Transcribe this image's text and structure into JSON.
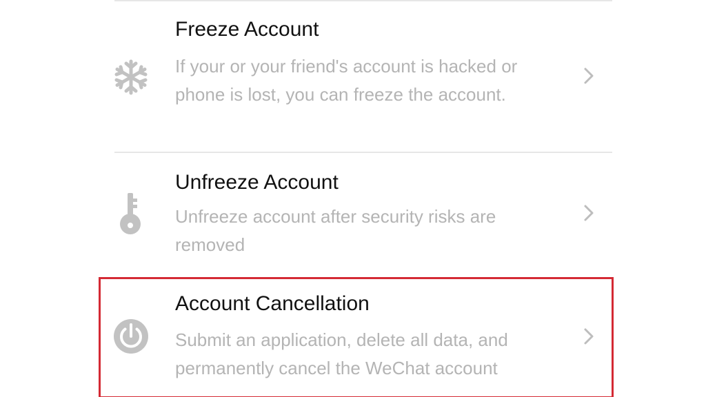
{
  "menu": {
    "items": [
      {
        "title": "Freeze Account",
        "description": "If your or your friend's account is hacked or phone is lost, you can freeze the account.",
        "icon": "snowflake-icon"
      },
      {
        "title": "Unfreeze Account",
        "description": "Unfreeze account after security risks are removed",
        "icon": "key-icon"
      },
      {
        "title": "Account Cancellation",
        "description": "Submit an application, delete all data, and permanently cancel the WeChat account",
        "icon": "power-icon"
      }
    ]
  },
  "colors": {
    "title_text": "#111111",
    "description_text": "#b4b4b4",
    "icon_gray": "#c2c2c2",
    "highlight_border": "#d42a34",
    "divider": "#e6e6e6"
  }
}
